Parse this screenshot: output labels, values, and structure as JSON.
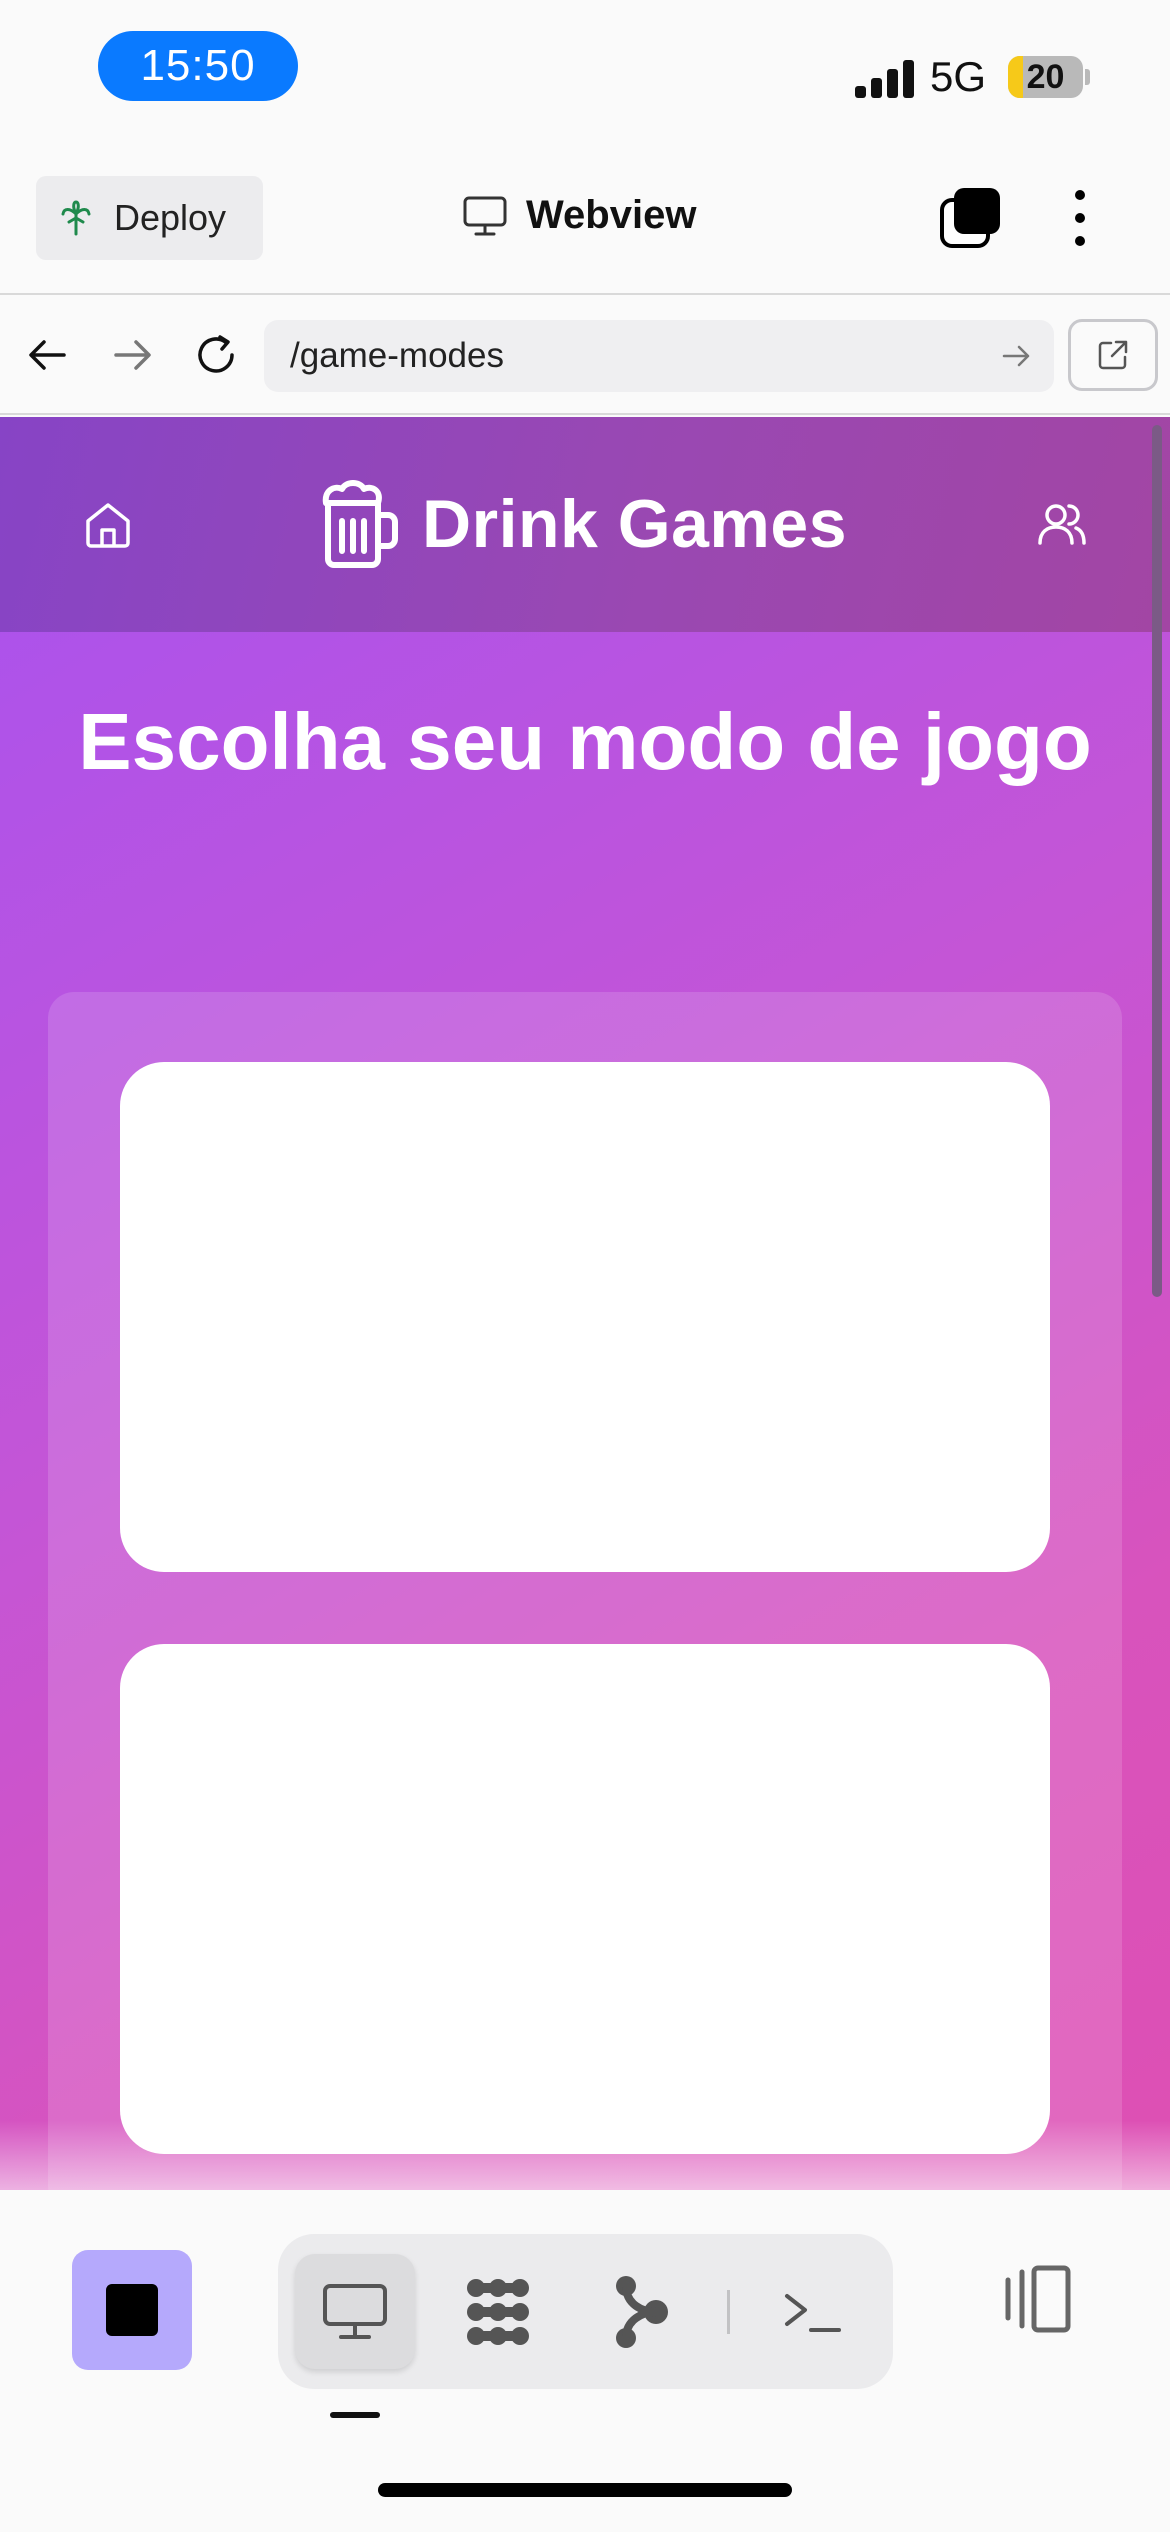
{
  "status_bar": {
    "time": "15:50",
    "network": "5G",
    "battery_level": "20",
    "battery_fraction": 0.2,
    "time_pill_color": "#0a7aff"
  },
  "app_bar": {
    "deploy_label": "Deploy",
    "title": "Webview",
    "icons": [
      "deploy-icon",
      "monitor-icon",
      "layers-icon",
      "more-vertical-icon"
    ]
  },
  "url_bar": {
    "url": "/game-modes",
    "icons": [
      "back-arrow-icon",
      "forward-arrow-icon",
      "reload-icon",
      "go-arrow-icon",
      "external-link-icon"
    ]
  },
  "site": {
    "brand_name": "Drink Games",
    "heading": "Escolha seu modo de jogo",
    "icons": [
      "home-icon",
      "beer-mug-icon",
      "users-icon"
    ],
    "gradient_colors": [
      "#a852ef",
      "#de4fb3"
    ],
    "header_color": "#8443c2",
    "mode_cards_count": 2
  },
  "bottom_toolbar": {
    "icons": [
      "stop-icon",
      "webview-monitor-icon",
      "workflow-icon",
      "git-branch-icon",
      "terminal-icon",
      "panels-icon"
    ],
    "stop_color": "#b5a9fc",
    "active_tool": "webview"
  }
}
